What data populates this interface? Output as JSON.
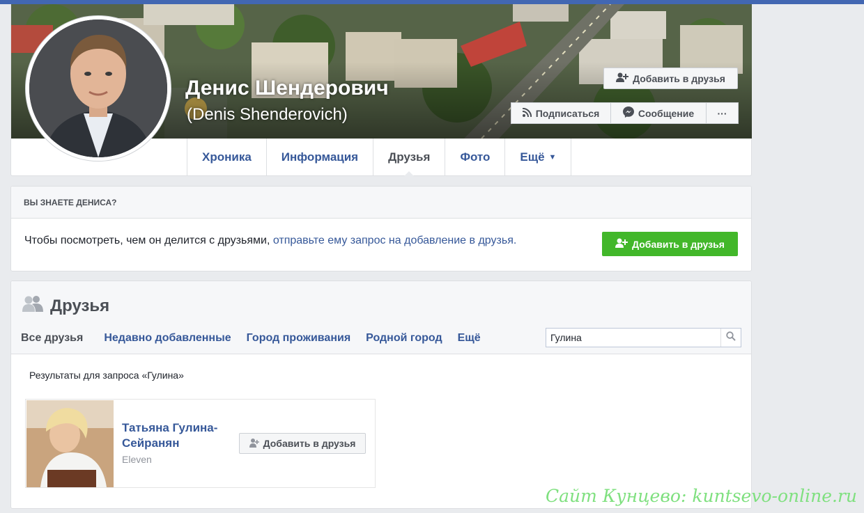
{
  "profile": {
    "name": "Денис Шендерович",
    "alt_name": "(Denis Shenderovich)",
    "add_friend_label": "Добавить в друзья",
    "follow_label": "Подписаться",
    "message_label": "Сообщение",
    "more_label": "···"
  },
  "tabs": [
    {
      "label": "Хроника"
    },
    {
      "label": "Информация"
    },
    {
      "label": "Друзья"
    },
    {
      "label": "Фото"
    },
    {
      "label": "Ещё"
    }
  ],
  "know_card": {
    "heading": "ВЫ ЗНАЕТЕ ДЕНИСА?",
    "text_plain": "Чтобы посмотреть, чем он делится с друзьями,",
    "text_link": "отправьте ему запрос на добавление в друзья.",
    "button_label": "Добавить в друзья"
  },
  "friends": {
    "title": "Друзья",
    "tabs": [
      "Все друзья",
      "Недавно добавленные",
      "Город проживания",
      "Родной город",
      "Ещё"
    ],
    "search_value": "Гулина",
    "results_label": "Результаты для запроса «Гулина»",
    "results": [
      {
        "name": "Татьяна Гулина-Сейранян",
        "subtitle": "Eleven",
        "button_label": "Добавить в друзья"
      }
    ]
  },
  "watermark": "Сайт Кунцево:  kuntsevo-online.ru",
  "colors": {
    "brand_blue": "#4267b2",
    "link_blue": "#365899",
    "green": "#42b72a",
    "watermark_green": "#7fe07f"
  },
  "icons": [
    "add-friend-icon",
    "rss-icon",
    "messenger-icon",
    "friends-icon",
    "search-icon",
    "chevron-down-icon"
  ]
}
